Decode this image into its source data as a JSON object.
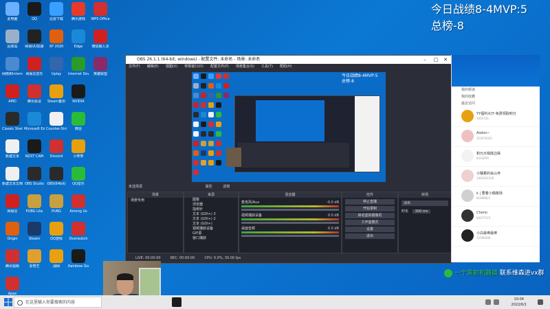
{
  "overlay": {
    "line1": "今日战绩8-4MVP:5",
    "line2": "总榜-8"
  },
  "desktop_icons": [
    {
      "label": "此电脑",
      "color": "#6ab0ff"
    },
    {
      "label": "QQ",
      "color": "#1a1a1a"
    },
    {
      "label": "迅雷下载",
      "color": "#3aa0ff"
    },
    {
      "label": "腾讯游戏",
      "color": "#e83a2a"
    },
    {
      "label": "WPS Office",
      "color": "#d03030"
    },
    {
      "label": "回收站",
      "color": "#9ab0c8"
    },
    {
      "label": "网易UU加速",
      "color": "#222"
    },
    {
      "label": "XP 2020",
      "color": "#e06010"
    },
    {
      "label": "Edge",
      "color": "#1a8ad8"
    },
    {
      "label": "微信输入法",
      "color": "#d02020"
    },
    {
      "label": "网络和Internet",
      "color": "#4a8ad0"
    },
    {
      "label": "网易云音乐",
      "color": "#d02020"
    },
    {
      "label": "Uplay",
      "color": "#3366aa"
    },
    {
      "label": "Internet Download",
      "color": "#2a9a2a"
    },
    {
      "label": "英雄联盟",
      "color": "#8a2a6a"
    },
    {
      "label": "AMD",
      "color": "#d02020"
    },
    {
      "label": "腾讯会议",
      "color": "#d03030"
    },
    {
      "label": "Steam备份",
      "color": "#e8a010"
    },
    {
      "label": "NVIDIA",
      "color": "#1a1a1a"
    },
    {
      "label": "Classic Shell",
      "color": "#2a2a2a"
    },
    {
      "label": "Microsoft Edge",
      "color": "#1a8ad8"
    },
    {
      "label": "Counter-Strike",
      "color": "#f0f0f0"
    },
    {
      "label": "微信",
      "color": "#2bbb3b"
    },
    {
      "label": "新建文本",
      "color": "#f0f0f0"
    },
    {
      "label": "NZXT CAM",
      "color": "#1a1a1a"
    },
    {
      "label": "Discord",
      "color": "#d03030"
    },
    {
      "label": "小乖乖",
      "color": "#e8a010"
    },
    {
      "label": "新建文本文档",
      "color": "#f0f0f0"
    },
    {
      "label": "OBS Studio",
      "color": "#2a2a2a"
    },
    {
      "label": "OBS(64bit)",
      "color": "#2a2a2a"
    },
    {
      "label": "QQ音乐",
      "color": "#2bbb3b"
    },
    {
      "label": "网易云",
      "color": "#d02020"
    },
    {
      "label": "PUBG Lite",
      "color": "#c8a040"
    },
    {
      "label": "PUBG",
      "color": "#c8a040"
    },
    {
      "label": "Among Us",
      "color": "#d03030"
    },
    {
      "label": "Origin",
      "color": "#e06010"
    },
    {
      "label": "Steam",
      "color": "#1a3a6a"
    },
    {
      "label": "QQ游戏",
      "color": "#e8a010"
    },
    {
      "label": "Overwatch",
      "color": "#d03030"
    },
    {
      "label": "腾讯视频",
      "color": "#d03030"
    },
    {
      "label": "爱奇艺",
      "color": "#e0a030"
    },
    {
      "label": "战网",
      "color": "#e8a010"
    },
    {
      "label": "Rainbow Six",
      "color": "#1a1a1a"
    },
    {
      "label": "Apex",
      "color": "#d03030"
    }
  ],
  "obs": {
    "title": "OBS 26.1.1 (64-bit, windows) - 配置文件: 未命名 - 场景: 未命名",
    "menu": [
      "文件(F)",
      "编辑(E)",
      "视图(V)",
      "停靠窗口(D)",
      "配置文件(P)",
      "场景集合(S)",
      "工具(T)",
      "帮助(H)"
    ],
    "no_source": "未选择源",
    "props": "属性",
    "filters": "滤镜",
    "scenes_header": "场景",
    "sources_header": "来源",
    "mixer_header": "混音器",
    "transitions_header": "转场",
    "controls_header": "控件",
    "scene_item": "场景专用",
    "sources": [
      "图像",
      "浏览器",
      "指南针",
      "文本 (GDI+) 3",
      "文本 (GDI+) 2",
      "文本 (GDI+)",
      "视频捕获设备",
      "GIF源",
      "窗口捕获"
    ],
    "mixer": [
      {
        "name": "麦克风/Aux",
        "db": "-0.0 dB"
      },
      {
        "name": "视频捕获设备",
        "db": "0.0 dB"
      },
      {
        "name": "桌面音频",
        "db": "0.0 dB"
      }
    ],
    "controls": [
      "停止直播",
      "开始录制",
      "启动虚拟摄像机",
      "工作室模式",
      "设置",
      "退出"
    ],
    "transition_value": "淡出",
    "duration_label": "时长",
    "duration_value": "300 ms",
    "status": [
      "LIVE: 00:00:00",
      "REC: 00:00:00",
      "CPU: 0.0%, 30.00 fps"
    ]
  },
  "qq": {
    "nav": [
      "我的频道",
      "我的收藏",
      "最近访问"
    ],
    "contacts": [
      {
        "name": "YY福利大厅-免费领取积分",
        "sub": "345572b"
      },
      {
        "name": "Aiolos~",
        "sub": "321076321"
      },
      {
        "name": "和元大锅底边缘",
        "sub": "8333059"
      },
      {
        "name": "小睡着的会山寺",
        "sub": "1463201520"
      },
      {
        "name": "k    | 要着小偶像场",
        "sub": "61896821"
      },
      {
        "name": "Chenn",
        "sub": "93077373"
      },
      {
        "name": "小白最棒最棒",
        "sub": "72599296"
      }
    ]
  },
  "wechat_banner": {
    "prefix": "一个发射机器搞",
    "text": "联系维森进vx群"
  },
  "taskbar": {
    "search_placeholder": "在这里输入你要搜索的内容",
    "time": "10:04",
    "date": "2022/6/1"
  }
}
